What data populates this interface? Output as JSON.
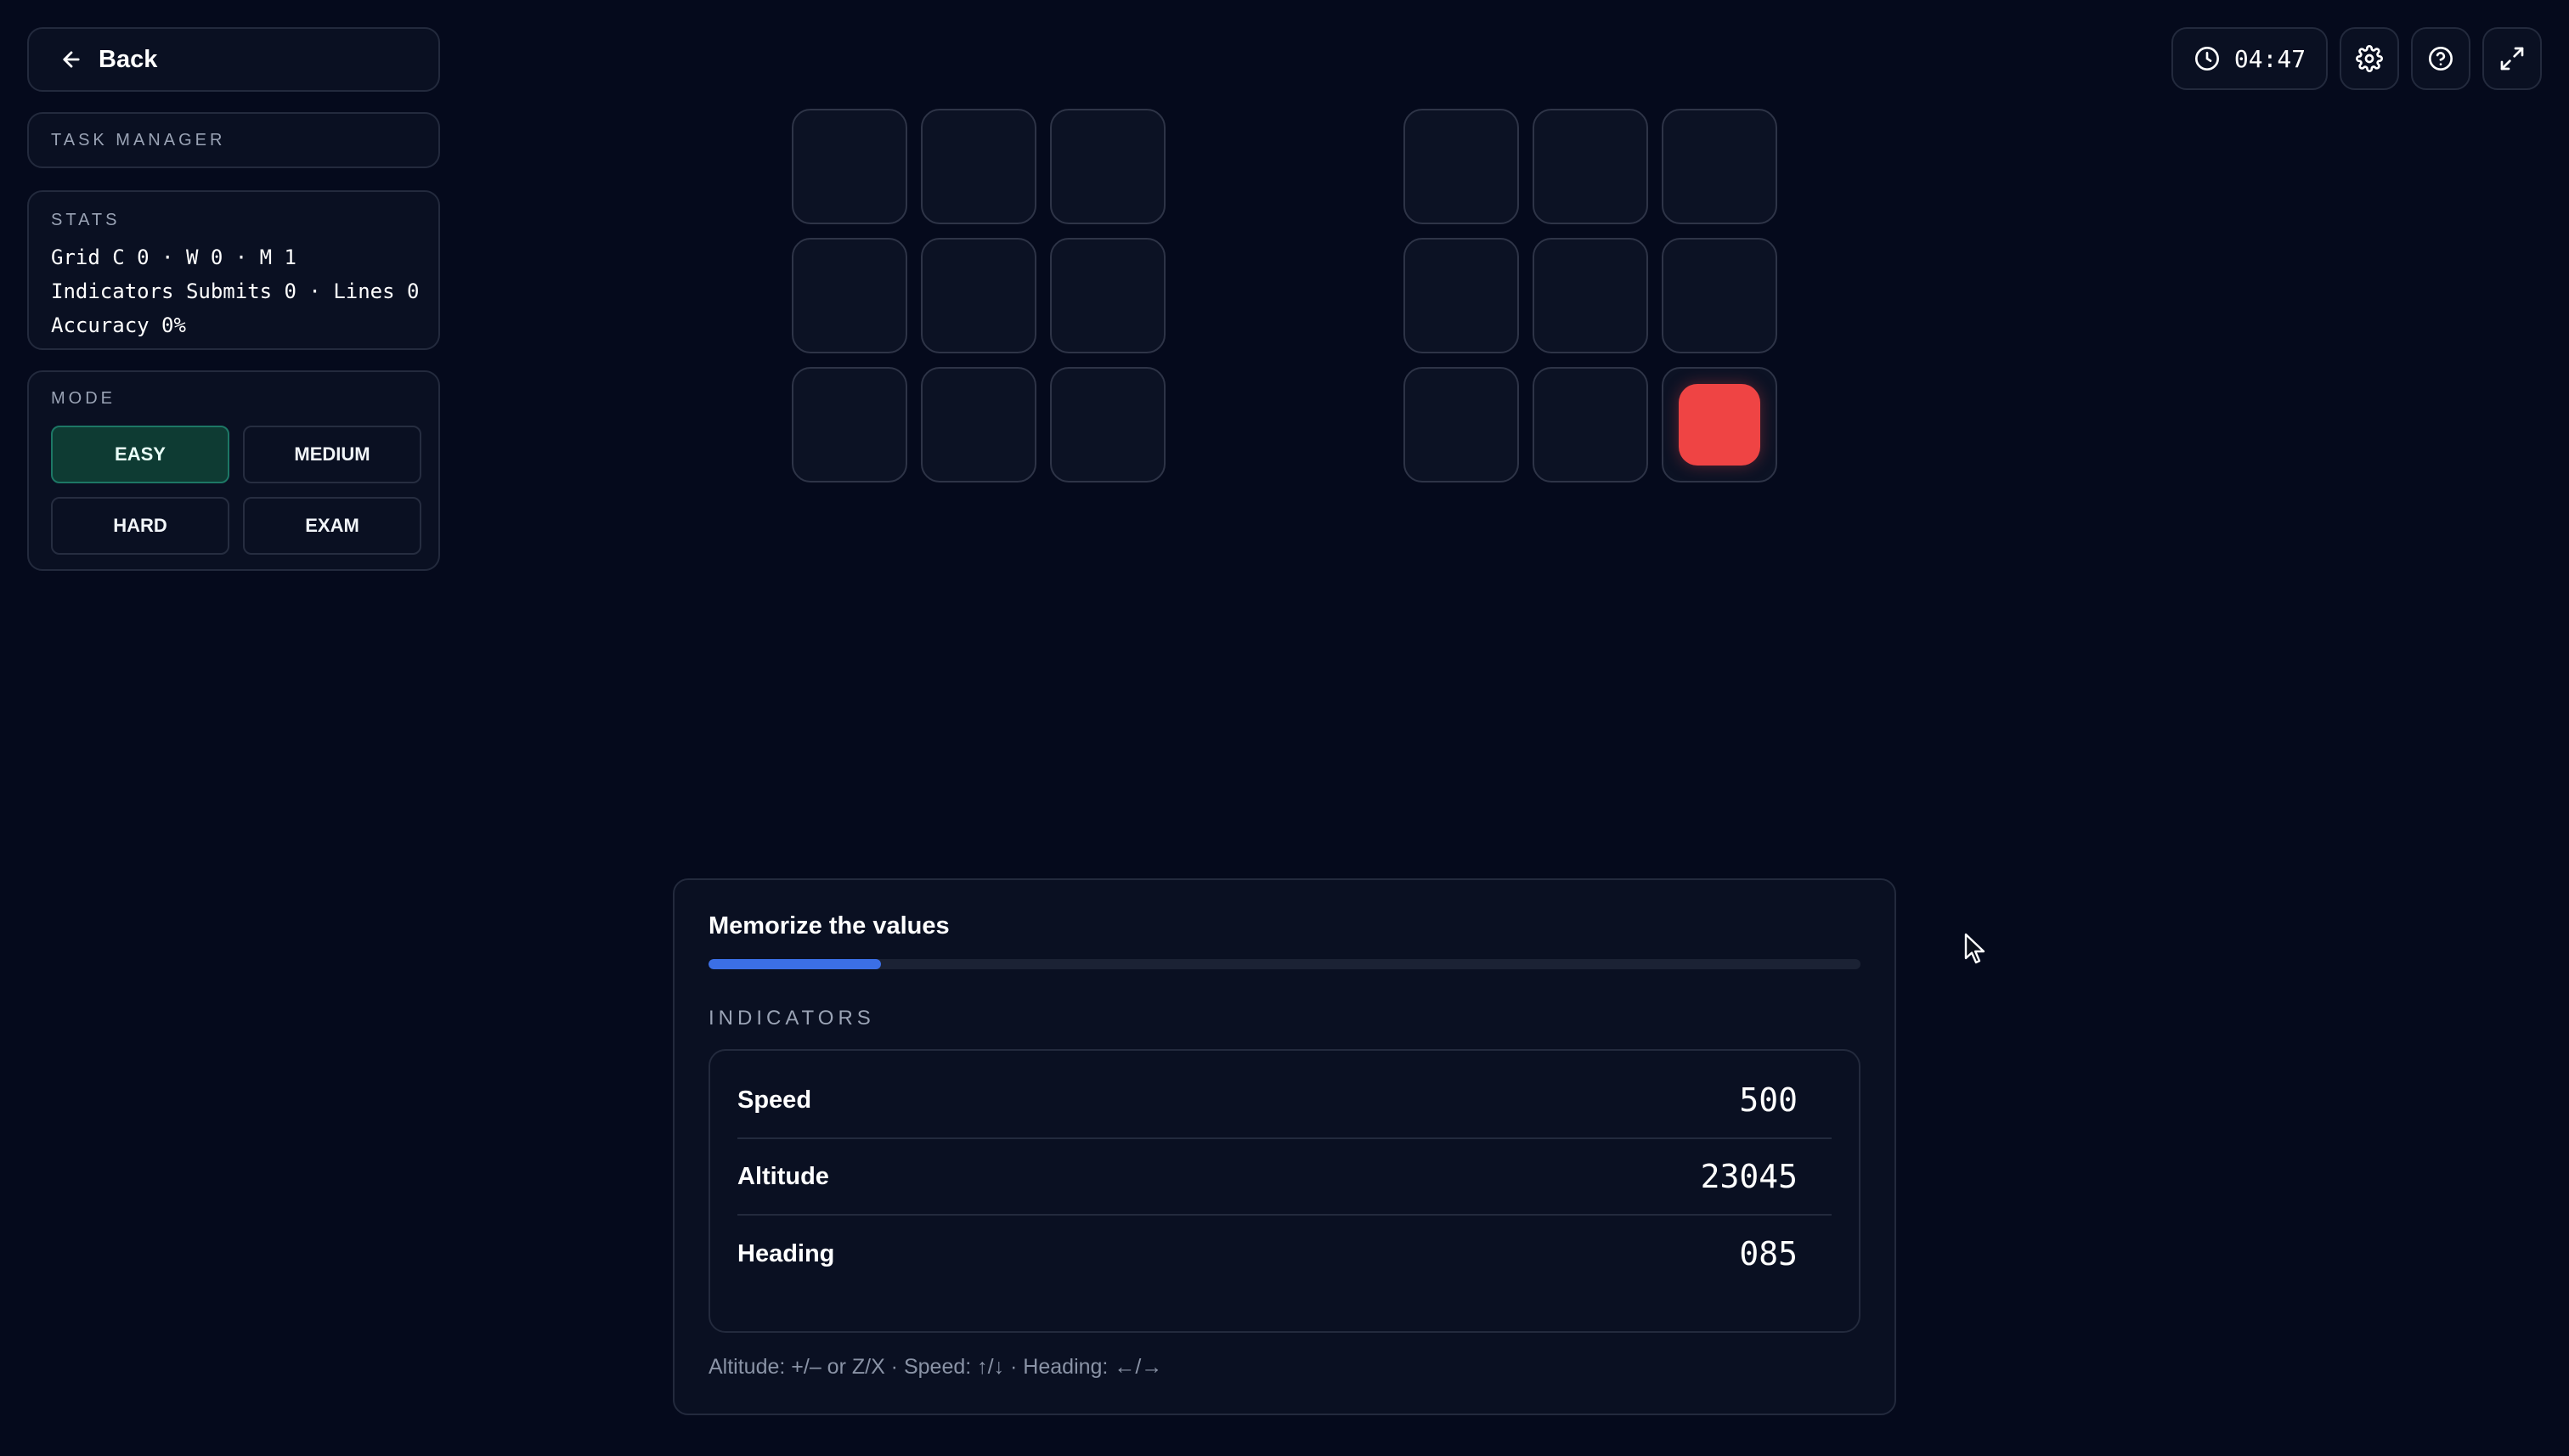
{
  "sidebar": {
    "back_label": "Back",
    "task_manager_label": "TASK MANAGER",
    "stats": {
      "heading": "STATS",
      "lines": [
        "Grid C 0 · W 0 · M 1",
        "Indicators Submits 0 · Lines 0",
        "Accuracy 0%"
      ]
    },
    "mode": {
      "heading": "MODE",
      "options": [
        "EASY",
        "MEDIUM",
        "HARD",
        "EXAM"
      ],
      "selected": "EASY"
    }
  },
  "topbar": {
    "timer": "04:47",
    "icons": [
      "clock-icon",
      "gear-icon",
      "help-icon",
      "fullscreen-icon"
    ]
  },
  "grids": {
    "left": {
      "lit_cells": []
    },
    "right": {
      "lit_cells": [
        8
      ]
    },
    "lit_color": "#ef4444"
  },
  "memorize": {
    "title": "Memorize the values",
    "progress_percent": 15,
    "indicators_label": "INDICATORS",
    "indicators": [
      {
        "name": "Speed",
        "value": "500"
      },
      {
        "name": "Altitude",
        "value": "23045"
      },
      {
        "name": "Heading",
        "value": "085"
      }
    ],
    "hint": "Altitude: +/– or Z/X · Speed: ↑/↓ · Heading: ←/→"
  },
  "colors": {
    "background": "#050a1c",
    "accent_active": "#0e3b33",
    "progress": "#3b6fe6"
  }
}
